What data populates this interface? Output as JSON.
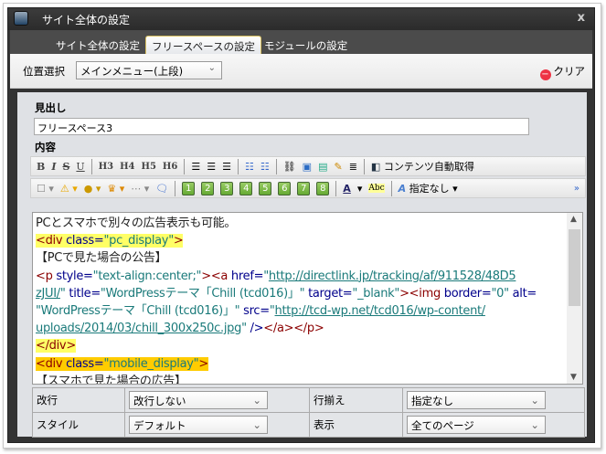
{
  "window": {
    "title": "サイト全体の設定",
    "close": "x"
  },
  "tabs": [
    {
      "label": "サイト全体の設定"
    },
    {
      "label": "フリースペースの設定",
      "active": true
    },
    {
      "label": "モジュールの設定"
    }
  ],
  "position": {
    "label": "位置選択",
    "value": "メインメニュー(上段)",
    "clear": "クリア"
  },
  "heading": {
    "label": "見出し",
    "value": "フリースペース3"
  },
  "content": {
    "label": "内容"
  },
  "toolbar1": {
    "bold": "B",
    "italic": "I",
    "strike": "S",
    "underline": "U",
    "h3": "H3",
    "h4": "H4",
    "h5": "H5",
    "h6": "H6",
    "auto_fetch": "コンテンツ自動取得"
  },
  "toolbar2": {
    "numbers": [
      "1",
      "2",
      "3",
      "4",
      "5",
      "6",
      "7",
      "8"
    ],
    "font_color": "A",
    "highlight": "Abc",
    "style_value": "指定なし",
    "more": "»"
  },
  "editor": {
    "lines": [
      [
        {
          "k": "t",
          "s": "PCとスマホで別々の広告表示も可能。"
        }
      ],
      [
        {
          "k": "tag",
          "s": "<div",
          "h": 1
        },
        {
          "k": "attr",
          "s": " class=",
          "h": 1
        },
        {
          "k": "val",
          "s": "\"pc_display\"",
          "h": 1
        },
        {
          "k": "tag",
          "s": ">  ",
          "h": 1
        }
      ],
      [
        {
          "k": "t",
          "s": "【PCで見た場合の公告】"
        }
      ],
      [
        {
          "k": "tag",
          "s": "<p"
        },
        {
          "k": "attr",
          "s": " style="
        },
        {
          "k": "val",
          "s": "\"text-align:center;\""
        },
        {
          "k": "tag",
          "s": "><a"
        },
        {
          "k": "attr",
          "s": " href="
        },
        {
          "k": "val",
          "s": "\""
        },
        {
          "k": "url",
          "s": "http://directlink.jp/tracking/af/911528/48D5"
        }
      ],
      [
        {
          "k": "url",
          "s": "zJUI/"
        },
        {
          "k": "val",
          "s": "\""
        },
        {
          "k": "attr",
          "s": " title="
        },
        {
          "k": "val",
          "s": "\"WordPressテーマ「Chill (tcd016)」\""
        },
        {
          "k": "attr",
          "s": " target="
        },
        {
          "k": "val",
          "s": "\"_blank\""
        },
        {
          "k": "tag",
          "s": "><img"
        },
        {
          "k": "attr",
          "s": " border="
        },
        {
          "k": "val",
          "s": "\"0\""
        },
        {
          "k": "attr",
          "s": " alt="
        }
      ],
      [
        {
          "k": "val",
          "s": "\"WordPressテーマ「Chill (tcd016)」\""
        },
        {
          "k": "attr",
          "s": " src="
        },
        {
          "k": "val",
          "s": "\""
        },
        {
          "k": "url",
          "s": "http://tcd-wp.net/tcd016/wp-content/"
        }
      ],
      [
        {
          "k": "url",
          "s": "uploads/2014/03/chill_300x250c.jpg"
        },
        {
          "k": "val",
          "s": "\""
        },
        {
          "k": "attr",
          "s": " />"
        },
        {
          "k": "tag",
          "s": "</a></p>"
        }
      ],
      [
        {
          "k": "tag",
          "s": "</div>      ",
          "h": 1
        }
      ],
      [
        {
          "k": "tag",
          "s": "<div",
          "h": 2
        },
        {
          "k": "attr",
          "s": " class=",
          "h": 2
        },
        {
          "k": "val",
          "s": "\"mobile_display\"",
          "h": 2
        },
        {
          "k": "tag",
          "s": ">      ",
          "h": 2
        }
      ],
      [
        {
          "k": "t",
          "s": "【スマホで見た場合の広告】"
        }
      ]
    ]
  },
  "options": [
    {
      "label": "改行",
      "value": "改行しない"
    },
    {
      "label": "行揃え",
      "value": "指定なし"
    },
    {
      "label": "スタイル",
      "value": "デフォルト"
    },
    {
      "label": "表示",
      "value": "全てのページ"
    }
  ]
}
